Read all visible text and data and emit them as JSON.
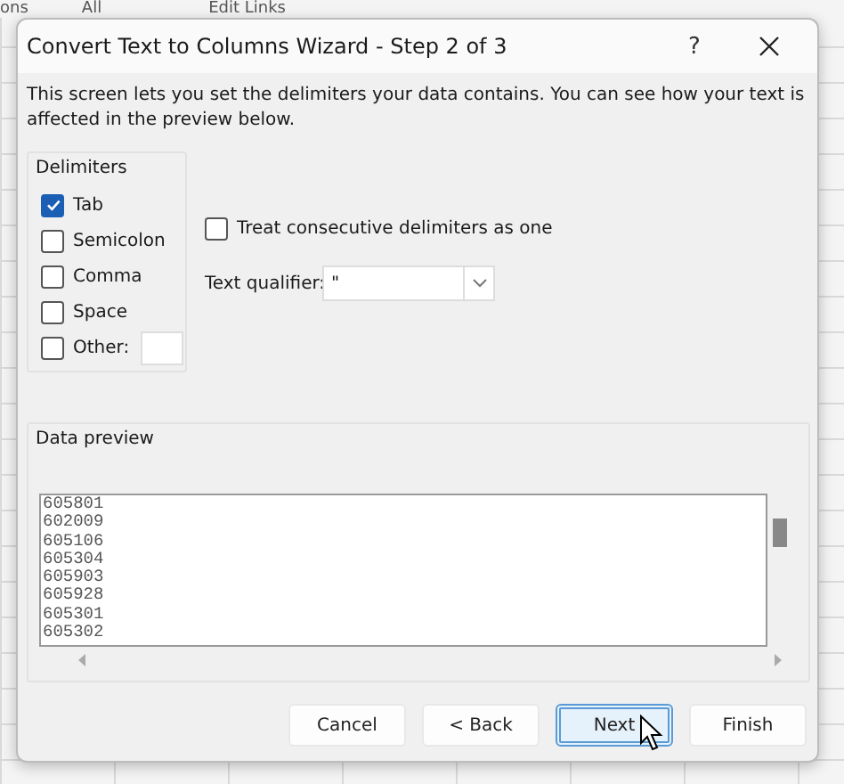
{
  "background_ribbon": [
    "ons",
    "All",
    "Edit Links"
  ],
  "window": {
    "title": "Convert Text to Columns Wizard - Step 2 of 3",
    "help": "?"
  },
  "description": "This screen lets you set the delimiters your data contains.  You can see how your text is affected in the preview below.",
  "delimiters": {
    "title": "Delimiters",
    "items": [
      {
        "label": "Tab",
        "checked": true
      },
      {
        "label": "Semicolon",
        "checked": false
      },
      {
        "label": "Comma",
        "checked": false
      },
      {
        "label": "Space",
        "checked": false
      },
      {
        "label": "Other:",
        "checked": false,
        "kind": "other"
      }
    ]
  },
  "treat_consecutive": {
    "label": "Treat consecutive delimiters as one",
    "checked": false
  },
  "text_qualifier": {
    "label": "Text qualifier:",
    "value": "\""
  },
  "data_preview": {
    "title": "Data preview",
    "rows": [
      "605801",
      "602009",
      "605106",
      "605304",
      "605903",
      "605928",
      "605301",
      "605302"
    ]
  },
  "buttons": [
    {
      "label": "Cancel",
      "focused": false
    },
    {
      "label": "< Back",
      "focused": false
    },
    {
      "label": "Next",
      "focused": true
    },
    {
      "label": "Finish",
      "focused": false
    }
  ]
}
